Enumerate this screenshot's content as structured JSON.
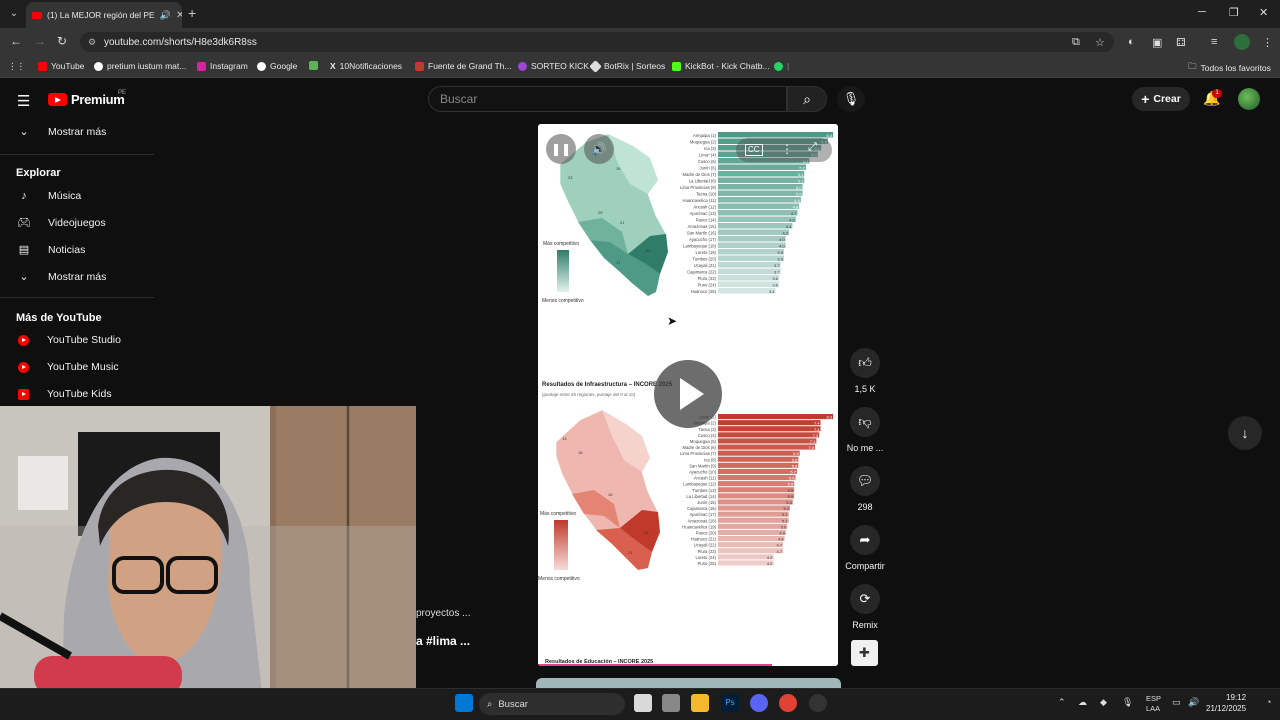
{
  "browser": {
    "tab_title": "(1) La MEJOR región del PE",
    "url": "youtube.com/shorts/H8e3dk6R8ss",
    "bookmarks": [
      "YouTube",
      "pretium iustum mat...",
      "Instagram",
      "Google",
      "10Notificaciones",
      "Fuente de Grand Th...",
      "SORTEO KICK",
      "BotRix | Sorteos",
      "KickBot - Kick Chatb..."
    ],
    "all_bookmarks": "Todos los favoritos"
  },
  "youtube": {
    "logo_text": "Premium",
    "logo_region": "PE",
    "search_placeholder": "Buscar",
    "create_label": "Crear",
    "notification_count": "1"
  },
  "sidebar": {
    "show_more_1": "Mostrar más",
    "explore_heading": "Explorar",
    "explore_items": [
      {
        "label": "Música",
        "icon": "music-note-icon"
      },
      {
        "label": "Videojuegos",
        "icon": "gamepad-icon"
      },
      {
        "label": "Noticias",
        "icon": "newspaper-icon"
      }
    ],
    "show_more_2": "Mostrar más",
    "more_heading": "Más de YouTube",
    "more_items": [
      "YouTube Studio",
      "YouTube Music",
      "YouTube Kids"
    ]
  },
  "actions": {
    "likes": "1,5 K",
    "dislike": "No me ...",
    "comments": "298",
    "share": "Compartir",
    "remix": "Remix"
  },
  "video_text": {
    "partial_1": "proyectos ...",
    "partial_2": "a #lima ..."
  },
  "chart1": {
    "legend_top": "Más competitivo",
    "legend_bottom": "Menos competitivo",
    "rows": [
      [
        "Arequipa (1)",
        "6.8"
      ],
      [
        "Moquegua (2)",
        "6.5"
      ],
      [
        "Ica (3)",
        "6.1"
      ],
      [
        "Lima* (4)",
        "5.9"
      ],
      [
        "Cusco (5)",
        "5.4"
      ],
      [
        "Junín (6)",
        "5.2"
      ],
      [
        "Madre de Dios (7)",
        "5.1"
      ],
      [
        "La Libertad (8)",
        "5.1"
      ],
      [
        "Lima Provincias (9)",
        "5.0"
      ],
      [
        "Tacna (10)",
        "5.0"
      ],
      [
        "Huancavelica (11)",
        "4.9"
      ],
      [
        "Áncash (12)",
        "4.8"
      ],
      [
        "Apurímac (13)",
        "4.7"
      ],
      [
        "Pasco (14)",
        "4.6"
      ],
      [
        "Amazonas (15)",
        "4.4"
      ],
      [
        "San Martín (16)",
        "4.2"
      ],
      [
        "Ayacucho (17)",
        "4.0"
      ],
      [
        "Lambayeque (18)",
        "4.0"
      ],
      [
        "Loreto (19)",
        "3.9"
      ],
      [
        "Tumbes (20)",
        "3.9"
      ],
      [
        "Ucayali (21)",
        "3.7"
      ],
      [
        "Cajamarca (22)",
        "3.7"
      ],
      [
        "Piura (23)",
        "3.6"
      ],
      [
        "Puno (24)",
        "3.6"
      ],
      [
        "Huánuco (25)",
        "3.4"
      ]
    ]
  },
  "chart2": {
    "title": "Resultados de Infraestructura – INCORE 2025",
    "subtitle": "(puntaje entre 25 regiones, puntaje del 0 al 10)",
    "legend_top": "Más competitivo",
    "legend_bottom": "Menos competitivo",
    "rows": [
      [
        "Lima* (1)",
        "8.3"
      ],
      [
        "Arequipa (2)",
        "7.4"
      ],
      [
        "Tacna (3)",
        "7.4"
      ],
      [
        "Cusco (4)",
        "7.3"
      ],
      [
        "Moquegua (5)",
        "7.1"
      ],
      [
        "Madre de Dios (6)",
        "7.0"
      ],
      [
        "Lima Provincias (7)",
        "5.9"
      ],
      [
        "Ica (8)",
        "5.8"
      ],
      [
        "San Martín (9)",
        "5.8"
      ],
      [
        "Ayacucho (10)",
        "5.7"
      ],
      [
        "Áncash (11)",
        "5.6"
      ],
      [
        "Lambayeque (12)",
        "5.5"
      ],
      [
        "Tumbes (13)",
        "5.5"
      ],
      [
        "La Libertad (14)",
        "5.5"
      ],
      [
        "Junín (15)",
        "5.4"
      ],
      [
        "Cajamarca (16)",
        "5.2"
      ],
      [
        "Apurímac (17)",
        "5.1"
      ],
      [
        "Amazonas (18)",
        "5.1"
      ],
      [
        "Huancavelica (19)",
        "5.0"
      ],
      [
        "Pasco (20)",
        "4.9"
      ],
      [
        "Huánuco (21)",
        "4.8"
      ],
      [
        "Ucayali (22)",
        "4.7"
      ],
      [
        "Piura (23)",
        "4.7"
      ],
      [
        "Loreto (24)",
        "4.0"
      ],
      [
        "Puno (25)",
        "4.0"
      ]
    ]
  },
  "chart3": {
    "title": "Resultados de Educación – INCORE 2025"
  },
  "taskbar": {
    "search": "Buscar",
    "lang_1": "ESP",
    "lang_2": "LAA",
    "time": "19:12",
    "date": "21/12/2025"
  },
  "colors": {
    "teal": "#4e9a86",
    "red": "#c0392b",
    "yt_red": "#ff0000"
  }
}
